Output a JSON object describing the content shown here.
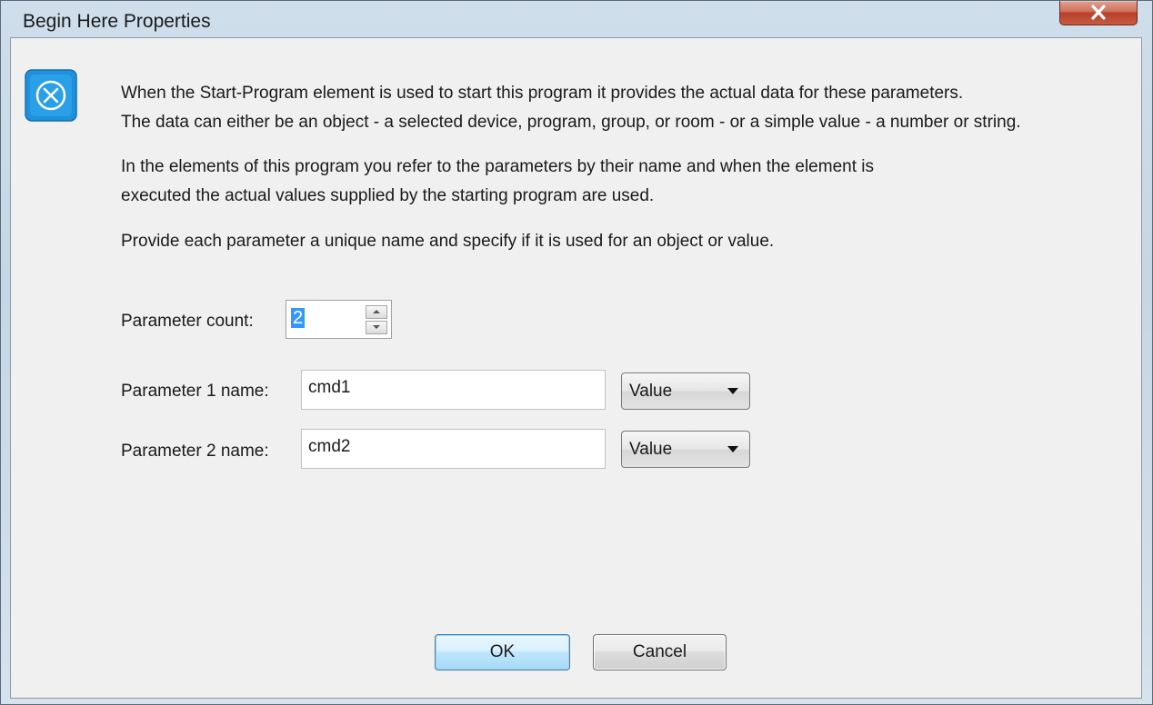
{
  "window": {
    "title": "Begin Here Properties"
  },
  "description": {
    "line1": "When the Start-Program element is used to start this program it provides the actual data for these parameters.",
    "line2": "The data can either be an object - a selected device, program, group, or room - or a simple value - a number or string.",
    "line3": "In the elements of this program you refer to the parameters by their name and when the element is",
    "line4": "executed the actual values supplied by the starting program are used.",
    "line5": "Provide each parameter a unique name and specify if it is used for an object or value."
  },
  "parameter_count": {
    "label": "Parameter count:",
    "value": "2"
  },
  "parameters": [
    {
      "label": "Parameter 1 name:",
      "name": "cmd1",
      "type": "Value"
    },
    {
      "label": "Parameter 2 name:",
      "name": "cmd2",
      "type": "Value"
    }
  ],
  "buttons": {
    "ok": "OK",
    "cancel": "Cancel"
  },
  "icons": {
    "info": "info-icon",
    "close": "close-icon"
  },
  "colors": {
    "icon_accent": "#1e90dc",
    "selection": "#3399ff",
    "close_button": "#c85a40"
  }
}
